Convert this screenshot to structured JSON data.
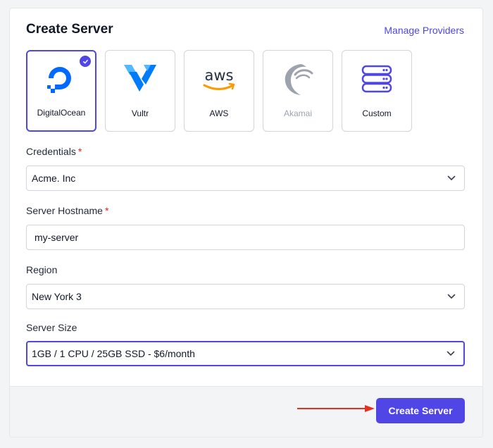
{
  "header": {
    "title": "Create Server",
    "manage_link": "Manage Providers"
  },
  "providers": [
    {
      "label": "DigitalOcean",
      "icon": "digitalocean-logo",
      "selected": true
    },
    {
      "label": "Vultr",
      "icon": "vultr-logo",
      "selected": false
    },
    {
      "label": "AWS",
      "icon": "aws-logo",
      "selected": false
    },
    {
      "label": "Akamai",
      "icon": "akamai-logo",
      "selected": false,
      "disabled": true
    },
    {
      "label": "Custom",
      "icon": "server-stack-icon",
      "selected": false
    }
  ],
  "form": {
    "credentials": {
      "label": "Credentials",
      "required_mark": "*",
      "value": "Acme. Inc"
    },
    "hostname": {
      "label": "Server Hostname",
      "required_mark": "*",
      "value": "my-server"
    },
    "region": {
      "label": "Region",
      "value": "New York 3"
    },
    "size": {
      "label": "Server Size",
      "value": "1GB / 1 CPU / 25GB SSD - $6/month"
    }
  },
  "footer": {
    "create_button": "Create Server"
  },
  "colors": {
    "accent": "#4f46e5",
    "required": "#dc2626",
    "annotation_arrow": "#e0321e"
  }
}
